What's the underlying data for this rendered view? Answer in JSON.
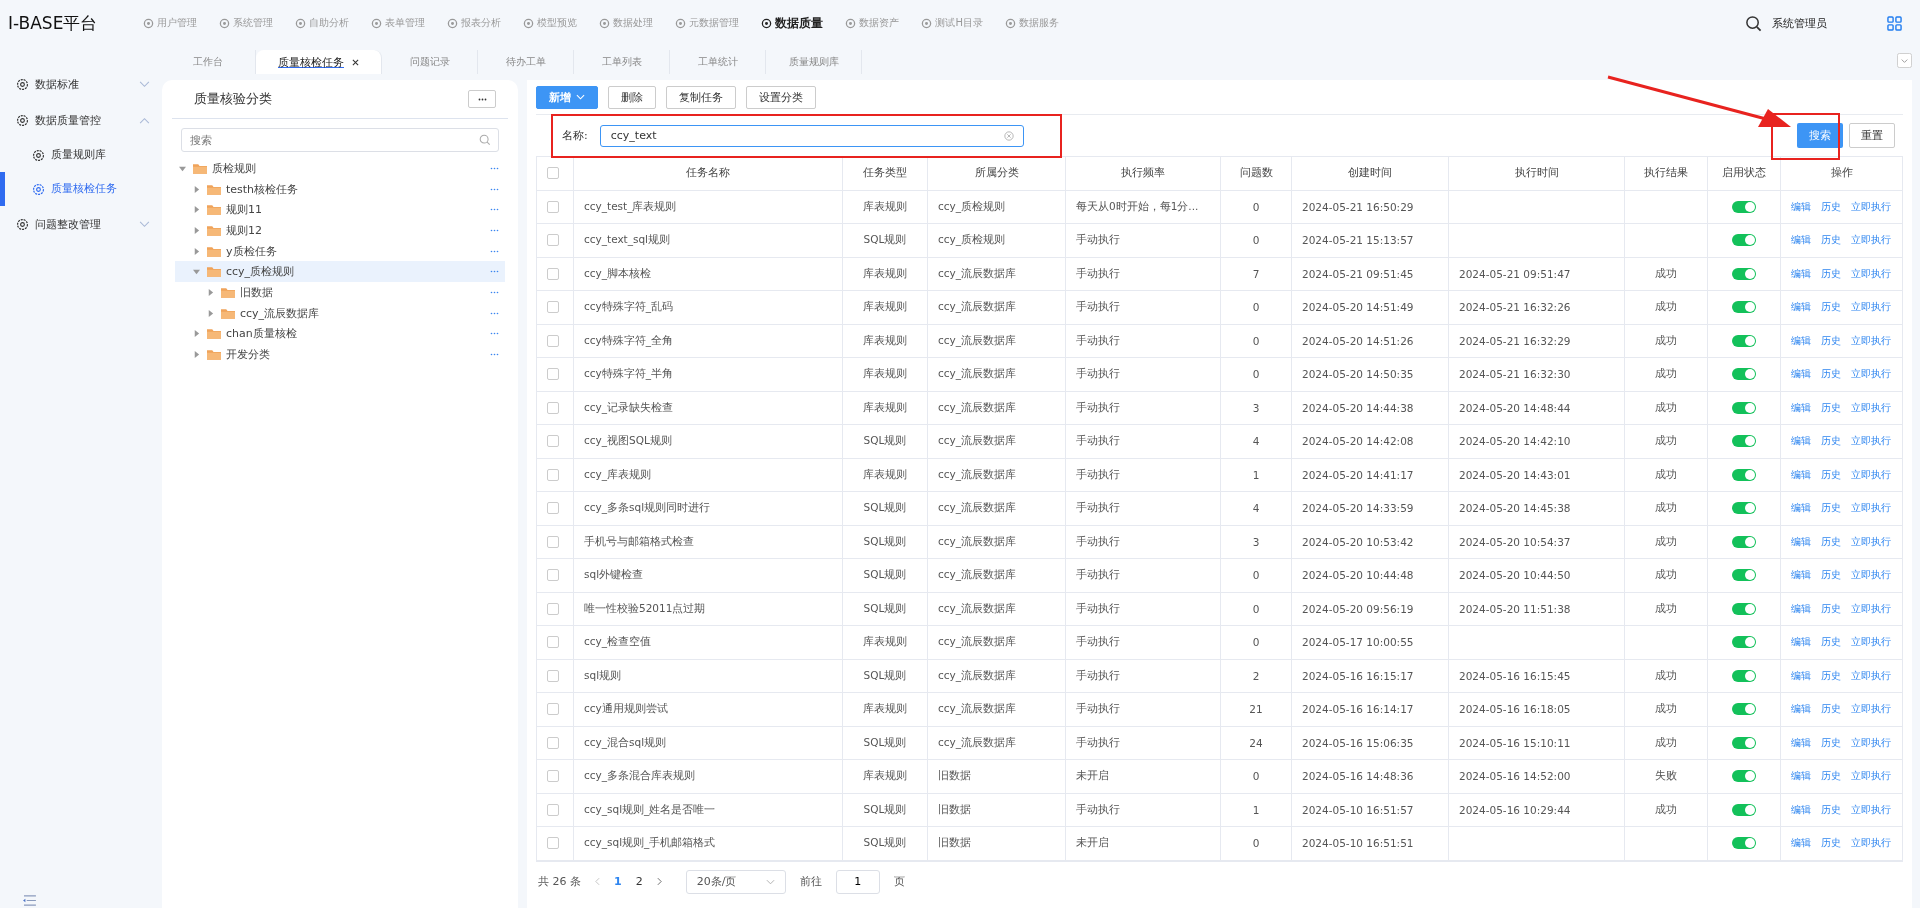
{
  "header": {
    "logo": "I-BASE平台",
    "nav": [
      {
        "label": "用户管理",
        "selected": false
      },
      {
        "label": "系统管理",
        "selected": false
      },
      {
        "label": "自助分析",
        "selected": false
      },
      {
        "label": "表单管理",
        "selected": false
      },
      {
        "label": "报表分析",
        "selected": false
      },
      {
        "label": "模型预览",
        "selected": false
      },
      {
        "label": "数据处理",
        "selected": false
      },
      {
        "label": "元数据管理",
        "selected": false
      },
      {
        "label": "数据质量",
        "selected": true
      },
      {
        "label": "数据资产",
        "selected": false
      },
      {
        "label": "测试H目录",
        "selected": false
      },
      {
        "label": "数据服务",
        "selected": false
      }
    ],
    "user": "系统管理员"
  },
  "tabs": [
    {
      "label": "工作台",
      "selected": false
    },
    {
      "label": "质量核检任务",
      "selected": true
    },
    {
      "label": "问题记录",
      "selected": false
    },
    {
      "label": "待办工单",
      "selected": false
    },
    {
      "label": "工单列表",
      "selected": false
    },
    {
      "label": "工单统计",
      "selected": false
    },
    {
      "label": "质量规则库",
      "selected": false
    }
  ],
  "sidebar": {
    "items": [
      {
        "label": "数据标准",
        "expanded": false,
        "selected": false
      },
      {
        "label": "数据质量管控",
        "expanded": true,
        "selected": false,
        "children": [
          {
            "label": "质量规则库",
            "selected": false
          },
          {
            "label": "质量核检任务",
            "selected": true
          }
        ]
      },
      {
        "label": "问题整改管理",
        "expanded": false,
        "selected": false
      }
    ]
  },
  "tree_panel": {
    "title": "质量核验分类",
    "search": {
      "placeholder": "搜索"
    },
    "nodes": [
      {
        "label": "质检规则",
        "expanded": true,
        "selected": false,
        "children": [
          {
            "label": "testh核检任务",
            "expanded": false,
            "selected": false
          },
          {
            "label": "规则11",
            "expanded": false,
            "selected": false
          },
          {
            "label": "规则12",
            "expanded": false,
            "selected": false
          },
          {
            "label": "y质检任务",
            "expanded": false,
            "selected": false
          },
          {
            "label": "ccy_质检规则",
            "expanded": true,
            "selected": true,
            "children": [
              {
                "label": "旧数据",
                "expanded": false,
                "selected": false
              },
              {
                "label": "ccy_流辰数据库",
                "expanded": false,
                "selected": false
              }
            ]
          },
          {
            "label": "chan质量核检",
            "expanded": false,
            "selected": false
          },
          {
            "label": "开发分类",
            "expanded": false,
            "selected": false
          }
        ]
      }
    ]
  },
  "toolbar": [
    {
      "label": "新增",
      "kind": "primary"
    },
    {
      "label": "删除",
      "kind": "plain"
    },
    {
      "label": "复制任务",
      "kind": "plain"
    },
    {
      "label": "设置分类",
      "kind": "plain"
    }
  ],
  "filter": {
    "label": "名称:",
    "value": "ccy_text",
    "search_button": "搜索",
    "reset_button": "重置"
  },
  "table": {
    "select_all": {
      "checked": false
    },
    "columns": [
      "任务名称",
      "任务类型",
      "所属分类",
      "执行频率",
      "问题数",
      "创建时间",
      "执行时间",
      "执行结果",
      "启用状态",
      "操作"
    ],
    "rows": [
      {
        "checked": false,
        "name": "ccy_test_库表规则",
        "type": "库表规则",
        "category": "ccy_质检规则",
        "frequency": "每天从0时开始，每1分...",
        "issues": "0",
        "created": "2024-05-21 16:50:29",
        "executed": "",
        "result": "",
        "enabled": true,
        "actions": [
          "编辑",
          "历史",
          "立即执行"
        ]
      },
      {
        "checked": false,
        "name": "ccy_text_sql规则",
        "type": "SQL规则",
        "category": "ccy_质检规则",
        "frequency": "手动执行",
        "issues": "0",
        "created": "2024-05-21 15:13:57",
        "executed": "",
        "result": "",
        "enabled": true,
        "actions": [
          "编辑",
          "历史",
          "立即执行"
        ]
      },
      {
        "checked": false,
        "name": "ccy_脚本核检",
        "type": "库表规则",
        "category": "ccy_流辰数据库",
        "frequency": "手动执行",
        "issues": "7",
        "created": "2024-05-21 09:51:45",
        "executed": "2024-05-21 09:51:47",
        "result": "成功",
        "enabled": true,
        "actions": [
          "编辑",
          "历史",
          "立即执行"
        ]
      },
      {
        "checked": false,
        "name": "ccy特殊字符_乱码",
        "type": "库表规则",
        "category": "ccy_流辰数据库",
        "frequency": "手动执行",
        "issues": "0",
        "created": "2024-05-20 14:51:49",
        "executed": "2024-05-21 16:32:26",
        "result": "成功",
        "enabled": true,
        "actions": [
          "编辑",
          "历史",
          "立即执行"
        ]
      },
      {
        "checked": false,
        "name": "ccy特殊字符_全角",
        "type": "库表规则",
        "category": "ccy_流辰数据库",
        "frequency": "手动执行",
        "issues": "0",
        "created": "2024-05-20 14:51:26",
        "executed": "2024-05-21 16:32:29",
        "result": "成功",
        "enabled": true,
        "actions": [
          "编辑",
          "历史",
          "立即执行"
        ]
      },
      {
        "checked": false,
        "name": "ccy特殊字符_半角",
        "type": "库表规则",
        "category": "ccy_流辰数据库",
        "frequency": "手动执行",
        "issues": "0",
        "created": "2024-05-20 14:50:35",
        "executed": "2024-05-21 16:32:30",
        "result": "成功",
        "enabled": true,
        "actions": [
          "编辑",
          "历史",
          "立即执行"
        ]
      },
      {
        "checked": false,
        "name": "ccy_记录缺失检查",
        "type": "库表规则",
        "category": "ccy_流辰数据库",
        "frequency": "手动执行",
        "issues": "3",
        "created": "2024-05-20 14:44:38",
        "executed": "2024-05-20 14:48:44",
        "result": "成功",
        "enabled": true,
        "actions": [
          "编辑",
          "历史",
          "立即执行"
        ]
      },
      {
        "checked": false,
        "name": "ccy_视图SQL规则",
        "type": "SQL规则",
        "category": "ccy_流辰数据库",
        "frequency": "手动执行",
        "issues": "4",
        "created": "2024-05-20 14:42:08",
        "executed": "2024-05-20 14:42:10",
        "result": "成功",
        "enabled": true,
        "actions": [
          "编辑",
          "历史",
          "立即执行"
        ]
      },
      {
        "checked": false,
        "name": "ccy_库表规则",
        "type": "库表规则",
        "category": "ccy_流辰数据库",
        "frequency": "手动执行",
        "issues": "1",
        "created": "2024-05-20 14:41:17",
        "executed": "2024-05-20 14:43:01",
        "result": "成功",
        "enabled": true,
        "actions": [
          "编辑",
          "历史",
          "立即执行"
        ]
      },
      {
        "checked": false,
        "name": "ccy_多条sql规则同时进行",
        "type": "SQL规则",
        "category": "ccy_流辰数据库",
        "frequency": "手动执行",
        "issues": "4",
        "created": "2024-05-20 14:33:59",
        "executed": "2024-05-20 14:45:38",
        "result": "成功",
        "enabled": true,
        "actions": [
          "编辑",
          "历史",
          "立即执行"
        ]
      },
      {
        "checked": false,
        "name": "手机号与邮箱格式检查",
        "type": "SQL规则",
        "category": "ccy_流辰数据库",
        "frequency": "手动执行",
        "issues": "3",
        "created": "2024-05-20 10:53:42",
        "executed": "2024-05-20 10:54:37",
        "result": "成功",
        "enabled": true,
        "actions": [
          "编辑",
          "历史",
          "立即执行"
        ]
      },
      {
        "checked": false,
        "name": "sql外键检查",
        "type": "SQL规则",
        "category": "ccy_流辰数据库",
        "frequency": "手动执行",
        "issues": "0",
        "created": "2024-05-20 10:44:48",
        "executed": "2024-05-20 10:44:50",
        "result": "成功",
        "enabled": true,
        "actions": [
          "编辑",
          "历史",
          "立即执行"
        ]
      },
      {
        "checked": false,
        "name": "唯一性校验52011点过期",
        "type": "SQL规则",
        "category": "ccy_流辰数据库",
        "frequency": "手动执行",
        "issues": "0",
        "created": "2024-05-20 09:56:19",
        "executed": "2024-05-20 11:51:38",
        "result": "成功",
        "enabled": true,
        "actions": [
          "编辑",
          "历史",
          "立即执行"
        ]
      },
      {
        "checked": false,
        "name": "ccy_检查空值",
        "type": "库表规则",
        "category": "ccy_流辰数据库",
        "frequency": "手动执行",
        "issues": "0",
        "created": "2024-05-17 10:00:55",
        "executed": "",
        "result": "",
        "enabled": true,
        "actions": [
          "编辑",
          "历史",
          "立即执行"
        ]
      },
      {
        "checked": false,
        "name": "sql规则",
        "type": "SQL规则",
        "category": "ccy_流辰数据库",
        "frequency": "手动执行",
        "issues": "2",
        "created": "2024-05-16 16:15:17",
        "executed": "2024-05-16 16:15:45",
        "result": "成功",
        "enabled": true,
        "actions": [
          "编辑",
          "历史",
          "立即执行"
        ]
      },
      {
        "checked": false,
        "name": "ccy通用规则尝试",
        "type": "库表规则",
        "category": "ccy_流辰数据库",
        "frequency": "手动执行",
        "issues": "21",
        "created": "2024-05-16 16:14:17",
        "executed": "2024-05-16 16:18:05",
        "result": "成功",
        "enabled": true,
        "actions": [
          "编辑",
          "历史",
          "立即执行"
        ]
      },
      {
        "checked": false,
        "name": "ccy_混合sql规则",
        "type": "SQL规则",
        "category": "ccy_流辰数据库",
        "frequency": "手动执行",
        "issues": "24",
        "created": "2024-05-16 15:06:35",
        "executed": "2024-05-16 15:10:11",
        "result": "成功",
        "enabled": true,
        "actions": [
          "编辑",
          "历史",
          "立即执行"
        ]
      },
      {
        "checked": false,
        "name": "ccy_多条混合库表规则",
        "type": "库表规则",
        "category": "旧数据",
        "frequency": "未开启",
        "issues": "0",
        "created": "2024-05-16 14:48:36",
        "executed": "2024-05-16 14:52:00",
        "result": "失败",
        "enabled": true,
        "actions": [
          "编辑",
          "历史",
          "立即执行"
        ]
      },
      {
        "checked": false,
        "name": "ccy_sql规则_姓名是否唯一",
        "type": "SQL规则",
        "category": "旧数据",
        "frequency": "手动执行",
        "issues": "1",
        "created": "2024-05-10 16:51:57",
        "executed": "2024-05-16 10:29:44",
        "result": "成功",
        "enabled": true,
        "actions": [
          "编辑",
          "历史",
          "立即执行"
        ]
      },
      {
        "checked": false,
        "name": "ccy_sql规则_手机邮箱格式",
        "type": "SQL规则",
        "category": "旧数据",
        "frequency": "未开启",
        "issues": "0",
        "created": "2024-05-10 16:51:51",
        "executed": "",
        "result": "",
        "enabled": true,
        "actions": [
          "编辑",
          "历史",
          "立即执行"
        ]
      }
    ]
  },
  "pagination": {
    "total": "共 26 条",
    "pages": [
      {
        "label": "1",
        "selected": true
      },
      {
        "label": "2",
        "selected": false
      }
    ],
    "page_size": "20条/页",
    "goto_label": "前往",
    "goto_value": "1",
    "goto_suffix": "页"
  }
}
